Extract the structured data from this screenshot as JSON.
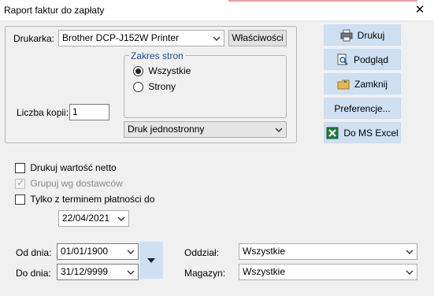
{
  "window": {
    "title": "Raport faktur do zapłaty",
    "close_symbol": "✕"
  },
  "printer": {
    "label": "Drukarka:",
    "selected": "Brother DCP-J152W Printer",
    "properties_button": "Właściwości"
  },
  "range": {
    "legend": "Zakres stron",
    "option_all": "Wszystkie",
    "option_pages": "Strony",
    "selected": "Wszystkie"
  },
  "copies": {
    "label": "Liczba kopii:",
    "value": "1"
  },
  "duplex": {
    "selected": "Druk jednostronny"
  },
  "actions": {
    "print": "Drukuj",
    "preview": "Podgląd",
    "close": "Zamknij",
    "preferences": "Preferencje...",
    "excel": "Do MS Excel"
  },
  "options": {
    "net_value": {
      "label": "Drukuj wartość netto",
      "checked": false,
      "enabled": true
    },
    "group_suppliers": {
      "label": "Grupuj wg dostawców",
      "checked": true,
      "enabled": false
    },
    "due_only": {
      "label": "Tylko z terminem płatności do",
      "checked": false,
      "enabled": true
    },
    "due_date": "22/04/2021"
  },
  "dates": {
    "from_label": "Od dnia:",
    "from_value": "01/01/1900",
    "to_label": "Do dnia:",
    "to_value": "31/12/9999"
  },
  "filters": {
    "branch_label": "Oddział:",
    "branch_value": "Wszystkie",
    "warehouse_label": "Magazyn:",
    "warehouse_value": "Wszystkie"
  },
  "colors": {
    "accent_panel": "#cfe0f3",
    "legend_text": "#1a50a0"
  }
}
